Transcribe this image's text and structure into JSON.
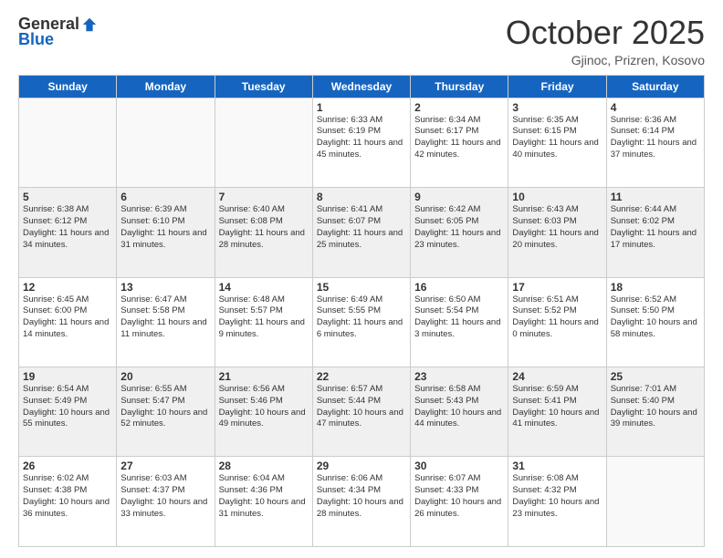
{
  "header": {
    "logo_general": "General",
    "logo_blue": "Blue",
    "month_title": "October 2025",
    "location": "Gjinoc, Prizren, Kosovo"
  },
  "weekdays": [
    "Sunday",
    "Monday",
    "Tuesday",
    "Wednesday",
    "Thursday",
    "Friday",
    "Saturday"
  ],
  "weeks": [
    [
      {
        "day": "",
        "sunrise": "",
        "sunset": "",
        "daylight": ""
      },
      {
        "day": "",
        "sunrise": "",
        "sunset": "",
        "daylight": ""
      },
      {
        "day": "",
        "sunrise": "",
        "sunset": "",
        "daylight": ""
      },
      {
        "day": "1",
        "sunrise": "Sunrise: 6:33 AM",
        "sunset": "Sunset: 6:19 PM",
        "daylight": "Daylight: 11 hours and 45 minutes."
      },
      {
        "day": "2",
        "sunrise": "Sunrise: 6:34 AM",
        "sunset": "Sunset: 6:17 PM",
        "daylight": "Daylight: 11 hours and 42 minutes."
      },
      {
        "day": "3",
        "sunrise": "Sunrise: 6:35 AM",
        "sunset": "Sunset: 6:15 PM",
        "daylight": "Daylight: 11 hours and 40 minutes."
      },
      {
        "day": "4",
        "sunrise": "Sunrise: 6:36 AM",
        "sunset": "Sunset: 6:14 PM",
        "daylight": "Daylight: 11 hours and 37 minutes."
      }
    ],
    [
      {
        "day": "5",
        "sunrise": "Sunrise: 6:38 AM",
        "sunset": "Sunset: 6:12 PM",
        "daylight": "Daylight: 11 hours and 34 minutes."
      },
      {
        "day": "6",
        "sunrise": "Sunrise: 6:39 AM",
        "sunset": "Sunset: 6:10 PM",
        "daylight": "Daylight: 11 hours and 31 minutes."
      },
      {
        "day": "7",
        "sunrise": "Sunrise: 6:40 AM",
        "sunset": "Sunset: 6:08 PM",
        "daylight": "Daylight: 11 hours and 28 minutes."
      },
      {
        "day": "8",
        "sunrise": "Sunrise: 6:41 AM",
        "sunset": "Sunset: 6:07 PM",
        "daylight": "Daylight: 11 hours and 25 minutes."
      },
      {
        "day": "9",
        "sunrise": "Sunrise: 6:42 AM",
        "sunset": "Sunset: 6:05 PM",
        "daylight": "Daylight: 11 hours and 23 minutes."
      },
      {
        "day": "10",
        "sunrise": "Sunrise: 6:43 AM",
        "sunset": "Sunset: 6:03 PM",
        "daylight": "Daylight: 11 hours and 20 minutes."
      },
      {
        "day": "11",
        "sunrise": "Sunrise: 6:44 AM",
        "sunset": "Sunset: 6:02 PM",
        "daylight": "Daylight: 11 hours and 17 minutes."
      }
    ],
    [
      {
        "day": "12",
        "sunrise": "Sunrise: 6:45 AM",
        "sunset": "Sunset: 6:00 PM",
        "daylight": "Daylight: 11 hours and 14 minutes."
      },
      {
        "day": "13",
        "sunrise": "Sunrise: 6:47 AM",
        "sunset": "Sunset: 5:58 PM",
        "daylight": "Daylight: 11 hours and 11 minutes."
      },
      {
        "day": "14",
        "sunrise": "Sunrise: 6:48 AM",
        "sunset": "Sunset: 5:57 PM",
        "daylight": "Daylight: 11 hours and 9 minutes."
      },
      {
        "day": "15",
        "sunrise": "Sunrise: 6:49 AM",
        "sunset": "Sunset: 5:55 PM",
        "daylight": "Daylight: 11 hours and 6 minutes."
      },
      {
        "day": "16",
        "sunrise": "Sunrise: 6:50 AM",
        "sunset": "Sunset: 5:54 PM",
        "daylight": "Daylight: 11 hours and 3 minutes."
      },
      {
        "day": "17",
        "sunrise": "Sunrise: 6:51 AM",
        "sunset": "Sunset: 5:52 PM",
        "daylight": "Daylight: 11 hours and 0 minutes."
      },
      {
        "day": "18",
        "sunrise": "Sunrise: 6:52 AM",
        "sunset": "Sunset: 5:50 PM",
        "daylight": "Daylight: 10 hours and 58 minutes."
      }
    ],
    [
      {
        "day": "19",
        "sunrise": "Sunrise: 6:54 AM",
        "sunset": "Sunset: 5:49 PM",
        "daylight": "Daylight: 10 hours and 55 minutes."
      },
      {
        "day": "20",
        "sunrise": "Sunrise: 6:55 AM",
        "sunset": "Sunset: 5:47 PM",
        "daylight": "Daylight: 10 hours and 52 minutes."
      },
      {
        "day": "21",
        "sunrise": "Sunrise: 6:56 AM",
        "sunset": "Sunset: 5:46 PM",
        "daylight": "Daylight: 10 hours and 49 minutes."
      },
      {
        "day": "22",
        "sunrise": "Sunrise: 6:57 AM",
        "sunset": "Sunset: 5:44 PM",
        "daylight": "Daylight: 10 hours and 47 minutes."
      },
      {
        "day": "23",
        "sunrise": "Sunrise: 6:58 AM",
        "sunset": "Sunset: 5:43 PM",
        "daylight": "Daylight: 10 hours and 44 minutes."
      },
      {
        "day": "24",
        "sunrise": "Sunrise: 6:59 AM",
        "sunset": "Sunset: 5:41 PM",
        "daylight": "Daylight: 10 hours and 41 minutes."
      },
      {
        "day": "25",
        "sunrise": "Sunrise: 7:01 AM",
        "sunset": "Sunset: 5:40 PM",
        "daylight": "Daylight: 10 hours and 39 minutes."
      }
    ],
    [
      {
        "day": "26",
        "sunrise": "Sunrise: 6:02 AM",
        "sunset": "Sunset: 4:38 PM",
        "daylight": "Daylight: 10 hours and 36 minutes."
      },
      {
        "day": "27",
        "sunrise": "Sunrise: 6:03 AM",
        "sunset": "Sunset: 4:37 PM",
        "daylight": "Daylight: 10 hours and 33 minutes."
      },
      {
        "day": "28",
        "sunrise": "Sunrise: 6:04 AM",
        "sunset": "Sunset: 4:36 PM",
        "daylight": "Daylight: 10 hours and 31 minutes."
      },
      {
        "day": "29",
        "sunrise": "Sunrise: 6:06 AM",
        "sunset": "Sunset: 4:34 PM",
        "daylight": "Daylight: 10 hours and 28 minutes."
      },
      {
        "day": "30",
        "sunrise": "Sunrise: 6:07 AM",
        "sunset": "Sunset: 4:33 PM",
        "daylight": "Daylight: 10 hours and 26 minutes."
      },
      {
        "day": "31",
        "sunrise": "Sunrise: 6:08 AM",
        "sunset": "Sunset: 4:32 PM",
        "daylight": "Daylight: 10 hours and 23 minutes."
      },
      {
        "day": "",
        "sunrise": "",
        "sunset": "",
        "daylight": ""
      }
    ]
  ]
}
